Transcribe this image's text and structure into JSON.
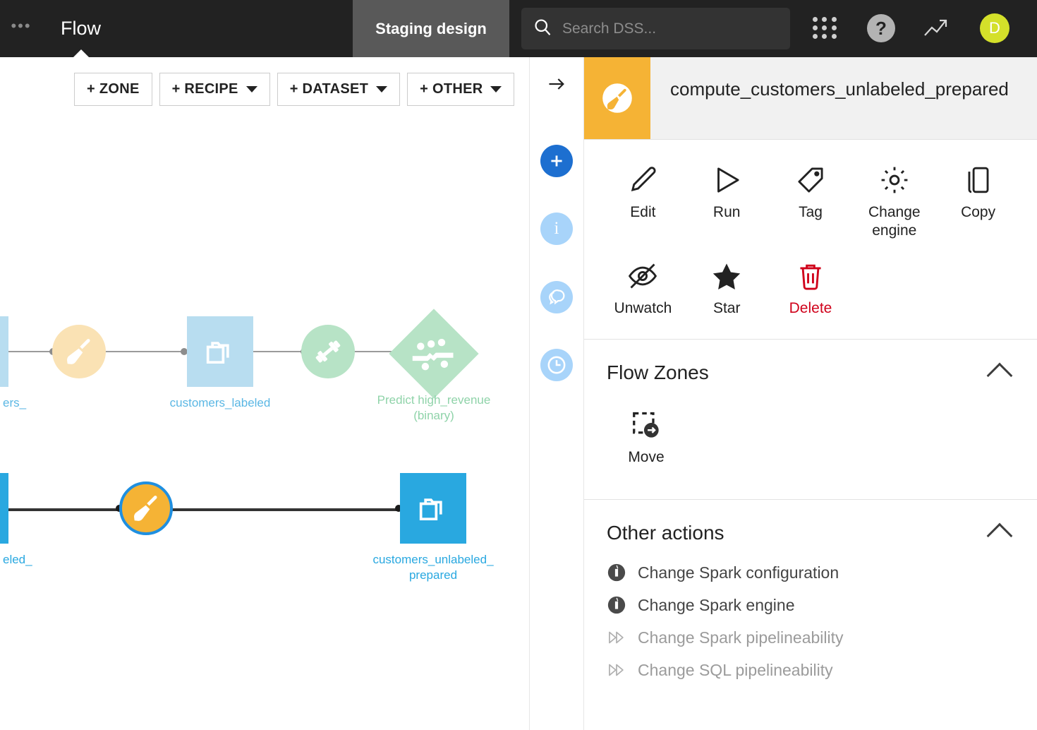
{
  "topbar": {
    "overflow_menu": "•••",
    "nav_label": "Flow",
    "tab_label": "Staging design",
    "search_placeholder": "Search DSS...",
    "search_value": "",
    "help_glyph": "?",
    "avatar_initial": "D"
  },
  "flow_toolbar": {
    "buttons": [
      {
        "label": "+ ZONE",
        "has_caret": false
      },
      {
        "label": "+ RECIPE",
        "has_caret": true
      },
      {
        "label": "+ DATASET",
        "has_caret": true
      },
      {
        "label": "+ OTHER",
        "has_caret": true
      }
    ]
  },
  "flow": {
    "nodes": [
      {
        "id": "customers_left",
        "label": "ers_",
        "type": "dataset",
        "color": "#b8ddf0"
      },
      {
        "id": "prepare_top",
        "label": "",
        "type": "recipe",
        "color": "#fae2b4"
      },
      {
        "id": "customers_labeled",
        "label": "customers_labeled",
        "type": "dataset",
        "color": "#b8ddf0"
      },
      {
        "id": "train_recipe",
        "label": "",
        "type": "train",
        "color": "#b7e3c6"
      },
      {
        "id": "predict_model",
        "label": "Predict high_revenue\n(binary)",
        "type": "model",
        "color": "#b7e3c6"
      },
      {
        "id": "customers_unlabeled",
        "label": "eled_",
        "type": "dataset",
        "color": "#29a8e0"
      },
      {
        "id": "prepare_selected",
        "label": "",
        "type": "recipe",
        "color": "#f5b335"
      },
      {
        "id": "customers_unlabeled_prepared",
        "label": "customers_unlabeled_\nprepared",
        "type": "dataset",
        "color": "#29a8e0"
      }
    ]
  },
  "rail": {
    "items": [
      {
        "name": "collapse-arrow",
        "icon": "arrow-right"
      },
      {
        "name": "add",
        "icon": "plus"
      },
      {
        "name": "details",
        "icon": "info"
      },
      {
        "name": "discussions",
        "icon": "chat"
      },
      {
        "name": "history",
        "icon": "clock"
      }
    ]
  },
  "panel": {
    "title": "compute_customers_unlabeled_prepared",
    "actions": [
      {
        "label": "Edit",
        "icon": "pencil-icon",
        "danger": false
      },
      {
        "label": "Run",
        "icon": "play-icon",
        "danger": false
      },
      {
        "label": "Tag",
        "icon": "tag-icon",
        "danger": false
      },
      {
        "label": "Change\nengine",
        "icon": "gear-icon",
        "danger": false
      },
      {
        "label": "Copy",
        "icon": "copy-icon",
        "danger": false
      },
      {
        "label": "Unwatch",
        "icon": "eye-off-icon",
        "danger": false
      },
      {
        "label": "Star",
        "icon": "star-icon",
        "danger": false
      },
      {
        "label": "Delete",
        "icon": "trash-icon",
        "danger": true
      }
    ],
    "flow_zones": {
      "title": "Flow Zones",
      "items": [
        {
          "label": "Move",
          "icon": "move-icon"
        }
      ]
    },
    "other_actions": {
      "title": "Other actions",
      "items": [
        {
          "label": "Change Spark configuration",
          "icon": "spark-icon",
          "disabled": false
        },
        {
          "label": "Change Spark engine",
          "icon": "spark-icon",
          "disabled": false
        },
        {
          "label": "Change Spark pipelineability",
          "icon": "pipeline-icon",
          "disabled": true
        },
        {
          "label": "Change SQL pipelineability",
          "icon": "pipeline-icon",
          "disabled": true
        }
      ]
    }
  },
  "colors": {
    "topbar_bg": "#222222",
    "tab_bg": "#595959",
    "accent_orange": "#f5b335",
    "accent_blue": "#29a8e0",
    "danger_red": "#d0021b",
    "avatar_green": "#d4e02a"
  }
}
